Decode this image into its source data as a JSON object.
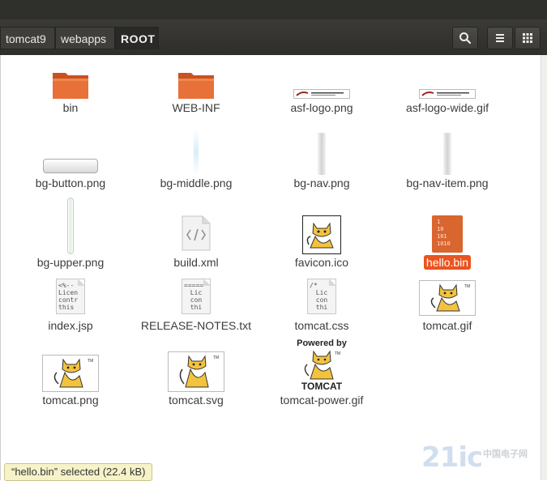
{
  "path_bar": {
    "crumbs": [
      "tomcat9",
      "webapps",
      "ROOT"
    ]
  },
  "toolbar_icons": [
    "search-icon",
    "list-view-icon",
    "grid-view-icon"
  ],
  "files": [
    {
      "name": "bin",
      "icon": "folder-icon"
    },
    {
      "name": "WEB-INF",
      "icon": "folder-icon"
    },
    {
      "name": "asf-logo.png",
      "icon": "image-thumbnail-icon"
    },
    {
      "name": "asf-logo-wide.gif",
      "icon": "image-thumbnail-icon"
    },
    {
      "name": "bg-button.png",
      "icon": "image-thumbnail-icon"
    },
    {
      "name": "bg-middle.png",
      "icon": "image-thumbnail-icon"
    },
    {
      "name": "bg-nav.png",
      "icon": "image-thumbnail-icon"
    },
    {
      "name": "bg-nav-item.png",
      "icon": "image-thumbnail-icon"
    },
    {
      "name": "bg-upper.png",
      "icon": "image-thumbnail-icon"
    },
    {
      "name": "build.xml",
      "icon": "code-file-icon"
    },
    {
      "name": "favicon.ico",
      "icon": "tomcat-thumbnail-icon"
    },
    {
      "name": "hello.bin",
      "icon": "binary-file-icon",
      "selected": true
    },
    {
      "name": "index.jsp",
      "icon": "text-file-icon",
      "preview": [
        "<%--",
        "Licen",
        "contr",
        "this"
      ]
    },
    {
      "name": "RELEASE-NOTES.txt",
      "icon": "text-file-icon",
      "preview": [
        "=====",
        "Lic",
        "con",
        "thi"
      ]
    },
    {
      "name": "tomcat.css",
      "icon": "text-file-icon",
      "preview": [
        "/*",
        "Lic",
        "con",
        "thi"
      ]
    },
    {
      "name": "tomcat.gif",
      "icon": "tomcat-thumbnail-icon"
    },
    {
      "name": "tomcat.png",
      "icon": "tomcat-thumbnail-icon"
    },
    {
      "name": "tomcat.svg",
      "icon": "tomcat-thumbnail-icon"
    },
    {
      "name": "tomcat-power.gif",
      "icon": "tomcat-power-thumbnail-icon",
      "thumb_text": {
        "top": "Powered by",
        "bottom": "TOMCAT"
      }
    }
  ],
  "binary_preview": [
    "1",
    "10",
    "101",
    "1010"
  ],
  "status": {
    "text": "“hello.bin” selected  (22.4 kB)"
  },
  "watermark": {
    "logo": "21ic",
    "sub": "中国电子网"
  },
  "colors": {
    "accent": "#e95420",
    "folder": "#e2672a",
    "toolbar": "#3b3a36"
  }
}
